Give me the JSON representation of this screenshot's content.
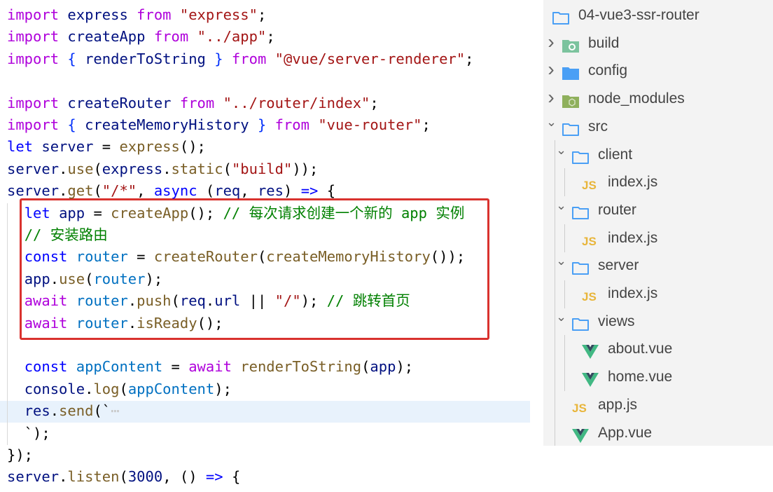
{
  "editor": {
    "lines": [
      [
        [
          "import",
          "kw"
        ],
        [
          " ",
          "ws"
        ],
        [
          "express",
          "id"
        ],
        [
          " ",
          "ws"
        ],
        [
          "from",
          "kw"
        ],
        [
          " ",
          "ws"
        ],
        [
          "\"express\"",
          "str"
        ],
        [
          ";",
          ""
        ]
      ],
      [
        [
          "import",
          "kw"
        ],
        [
          " ",
          "ws"
        ],
        [
          "createApp",
          "id"
        ],
        [
          " ",
          "ws"
        ],
        [
          "from",
          "kw"
        ],
        [
          " ",
          "ws"
        ],
        [
          "\"../app\"",
          "str"
        ],
        [
          ";",
          ""
        ]
      ],
      [
        [
          "import",
          "kw"
        ],
        [
          " ",
          "ws"
        ],
        [
          "{",
          "br"
        ],
        [
          " ",
          "ws"
        ],
        [
          "renderToString",
          "id"
        ],
        [
          " ",
          "ws"
        ],
        [
          "}",
          "br"
        ],
        [
          " ",
          "ws"
        ],
        [
          "from",
          "kw"
        ],
        [
          " ",
          "ws"
        ],
        [
          "\"@vue/server-renderer\"",
          "str"
        ],
        [
          ";",
          ""
        ]
      ],
      [],
      [
        [
          "import",
          "kw"
        ],
        [
          " ",
          "ws"
        ],
        [
          "createRouter",
          "id"
        ],
        [
          " ",
          "ws"
        ],
        [
          "from",
          "kw"
        ],
        [
          " ",
          "ws"
        ],
        [
          "\"../router/index\"",
          "str"
        ],
        [
          ";",
          ""
        ]
      ],
      [
        [
          "import",
          "kw"
        ],
        [
          " ",
          "ws"
        ],
        [
          "{",
          "br"
        ],
        [
          " ",
          "ws"
        ],
        [
          "createMemoryHistory",
          "id"
        ],
        [
          " ",
          "ws"
        ],
        [
          "}",
          "br"
        ],
        [
          " ",
          "ws"
        ],
        [
          "from",
          "kw"
        ],
        [
          " ",
          "ws"
        ],
        [
          "\"vue-router\"",
          "str"
        ],
        [
          ";",
          ""
        ]
      ],
      [
        [
          "let",
          "decl"
        ],
        [
          " ",
          "ws"
        ],
        [
          "server",
          "id"
        ],
        [
          " ",
          "ws"
        ],
        [
          "=",
          ""
        ],
        [
          " ",
          "ws"
        ],
        [
          "express",
          "fn"
        ],
        [
          "();",
          ""
        ]
      ],
      [
        [
          "server",
          "id"
        ],
        [
          ".",
          ""
        ],
        [
          "use",
          "fn"
        ],
        [
          "(",
          ""
        ],
        [
          "express",
          "id"
        ],
        [
          ".",
          ""
        ],
        [
          "static",
          "fn"
        ],
        [
          "(",
          ""
        ],
        [
          "\"build\"",
          "str"
        ],
        [
          "));",
          ""
        ]
      ],
      [
        [
          "server",
          "id"
        ],
        [
          ".",
          ""
        ],
        [
          "get",
          "fn"
        ],
        [
          "(",
          ""
        ],
        [
          "\"/*\"",
          "str"
        ],
        [
          ", ",
          ""
        ],
        [
          "async",
          "decl"
        ],
        [
          " ",
          "ws"
        ],
        [
          "(",
          ""
        ],
        [
          "req",
          "id"
        ],
        [
          ", ",
          ""
        ],
        [
          "res",
          "id"
        ],
        [
          ")",
          ""
        ],
        [
          " ",
          "ws"
        ],
        [
          "=>",
          "decl"
        ],
        [
          " ",
          "ws"
        ],
        [
          "{",
          ""
        ]
      ],
      [
        [
          "  ",
          "ws"
        ],
        [
          "let",
          "decl"
        ],
        [
          " ",
          "ws"
        ],
        [
          "app",
          "id"
        ],
        [
          " ",
          "ws"
        ],
        [
          "=",
          ""
        ],
        [
          " ",
          "ws"
        ],
        [
          "createApp",
          "fn"
        ],
        [
          "();",
          ""
        ],
        [
          " ",
          "ws"
        ],
        [
          "// 每次请求创建一个新的 app 实例",
          "cm"
        ]
      ],
      [
        [
          "  ",
          "ws"
        ],
        [
          "// 安装路由",
          "cm"
        ]
      ],
      [
        [
          "  ",
          "ws"
        ],
        [
          "const",
          "decl"
        ],
        [
          " ",
          "ws"
        ],
        [
          "router",
          "var"
        ],
        [
          " ",
          "ws"
        ],
        [
          "=",
          ""
        ],
        [
          " ",
          "ws"
        ],
        [
          "createRouter",
          "fn"
        ],
        [
          "(",
          ""
        ],
        [
          "createMemoryHistory",
          "fn"
        ],
        [
          "());",
          ""
        ]
      ],
      [
        [
          "  ",
          "ws"
        ],
        [
          "app",
          "id"
        ],
        [
          ".",
          ""
        ],
        [
          "use",
          "fn"
        ],
        [
          "(",
          ""
        ],
        [
          "router",
          "var"
        ],
        [
          ");",
          ""
        ]
      ],
      [
        [
          "  ",
          "ws"
        ],
        [
          "await",
          "kw"
        ],
        [
          " ",
          "ws"
        ],
        [
          "router",
          "var"
        ],
        [
          ".",
          ""
        ],
        [
          "push",
          "fn"
        ],
        [
          "(",
          ""
        ],
        [
          "req",
          "id"
        ],
        [
          ".",
          ""
        ],
        [
          "url",
          "id"
        ],
        [
          " ",
          "ws"
        ],
        [
          "||",
          ""
        ],
        [
          " ",
          "ws"
        ],
        [
          "\"/\"",
          "str"
        ],
        [
          ");",
          ""
        ],
        [
          " ",
          "ws"
        ],
        [
          "// 跳转首页",
          "cm"
        ]
      ],
      [
        [
          "  ",
          "ws"
        ],
        [
          "await",
          "kw"
        ],
        [
          " ",
          "ws"
        ],
        [
          "router",
          "var"
        ],
        [
          ".",
          ""
        ],
        [
          "isReady",
          "fn"
        ],
        [
          "();",
          ""
        ]
      ],
      [],
      [
        [
          "  ",
          "ws"
        ],
        [
          "const",
          "decl"
        ],
        [
          " ",
          "ws"
        ],
        [
          "appContent",
          "var"
        ],
        [
          " ",
          "ws"
        ],
        [
          "=",
          ""
        ],
        [
          " ",
          "ws"
        ],
        [
          "await",
          "kw"
        ],
        [
          " ",
          "ws"
        ],
        [
          "renderToString",
          "fn"
        ],
        [
          "(",
          ""
        ],
        [
          "app",
          "id"
        ],
        [
          ");",
          ""
        ]
      ],
      [
        [
          "  ",
          "ws"
        ],
        [
          "console",
          "id"
        ],
        [
          ".",
          ""
        ],
        [
          "log",
          "fn"
        ],
        [
          "(",
          ""
        ],
        [
          "appContent",
          "var"
        ],
        [
          ");",
          ""
        ]
      ],
      [
        [
          "  ",
          "ws"
        ],
        [
          "res",
          "id"
        ],
        [
          ".",
          ""
        ],
        [
          "send",
          "fn"
        ],
        [
          "(`",
          ""
        ],
        [
          "⋯",
          "ws"
        ]
      ],
      [
        [
          "  ",
          "ws"
        ],
        [
          "`);",
          ""
        ]
      ],
      [
        [
          "});",
          ""
        ]
      ],
      [
        [
          "server",
          "id"
        ],
        [
          ".",
          ""
        ],
        [
          "listen",
          "fn"
        ],
        [
          "(",
          ""
        ],
        [
          "3000",
          "id"
        ],
        [
          ", ",
          ""
        ],
        [
          "()",
          ""
        ],
        [
          " ",
          "ws"
        ],
        [
          "=>",
          "decl"
        ],
        [
          " ",
          "ws"
        ],
        [
          "{",
          ""
        ]
      ]
    ]
  },
  "explorer": {
    "items": [
      {
        "label": "04-vue3-ssr-router",
        "icon": "folder-outline",
        "chevron": "",
        "indent": 0
      },
      {
        "label": "build",
        "icon": "folder-build",
        "chevron": "right",
        "indent": 1
      },
      {
        "label": "config",
        "icon": "folder-config",
        "chevron": "right",
        "indent": 1
      },
      {
        "label": "node_modules",
        "icon": "folder-node",
        "chevron": "right",
        "indent": 1
      },
      {
        "label": "src",
        "icon": "folder-outline",
        "chevron": "down",
        "indent": 1
      },
      {
        "label": "client",
        "icon": "folder-outline",
        "chevron": "down",
        "indent": 2
      },
      {
        "label": "index.js",
        "icon": "js",
        "chevron": "",
        "indent": 3
      },
      {
        "label": "router",
        "icon": "folder-outline",
        "chevron": "down",
        "indent": 2
      },
      {
        "label": "index.js",
        "icon": "js",
        "chevron": "",
        "indent": 3
      },
      {
        "label": "server",
        "icon": "folder-outline",
        "chevron": "down",
        "indent": 2
      },
      {
        "label": "index.js",
        "icon": "js",
        "chevron": "",
        "indent": 3
      },
      {
        "label": "views",
        "icon": "folder-outline",
        "chevron": "down",
        "indent": 2
      },
      {
        "label": "about.vue",
        "icon": "vue",
        "chevron": "",
        "indent": 3
      },
      {
        "label": "home.vue",
        "icon": "vue",
        "chevron": "",
        "indent": 3
      },
      {
        "label": "app.js",
        "icon": "js",
        "chevron": "",
        "indent": 2
      },
      {
        "label": "App.vue",
        "icon": "vue",
        "chevron": "",
        "indent": 2
      }
    ]
  },
  "colors": {
    "highlight_box": "#d9322e",
    "folder": "#4a9ff5",
    "js": "#e8b53a",
    "vue_green": "#41b883",
    "vue_dark": "#34495e"
  }
}
